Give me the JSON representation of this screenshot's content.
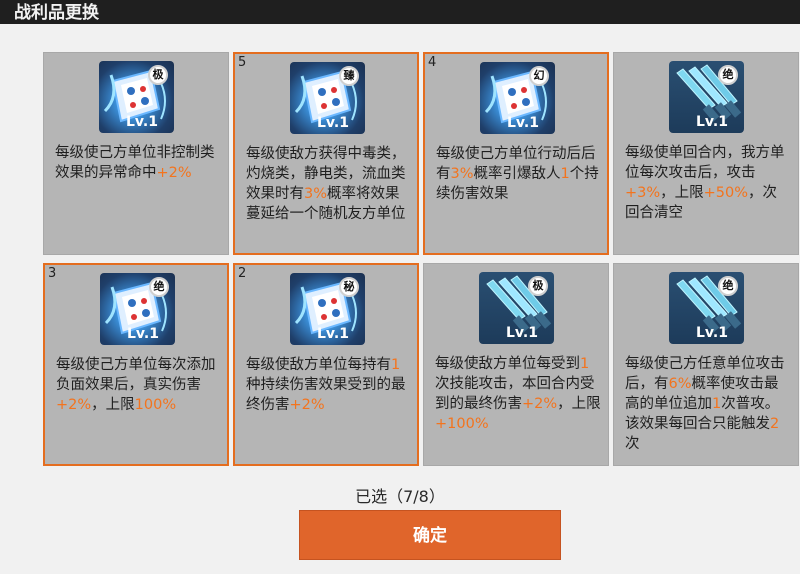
{
  "title": "战利品更换",
  "selected_text": "已选（7/8）",
  "confirm_label": "确定",
  "cards": [
    {
      "num": "",
      "icon": "card-icon",
      "badge": "极",
      "lvl": "Lv.1",
      "selected": false,
      "desc": [
        {
          "t": "每级使己方单位非控制类效果的异常命中"
        },
        {
          "t": "+2%",
          "h": 1
        }
      ]
    },
    {
      "num": "5",
      "icon": "card-icon",
      "badge": "臻",
      "lvl": "Lv.1",
      "selected": true,
      "desc": [
        {
          "t": "每级使敌方获得中毒类，灼烧类，静电类，流血类效果时有"
        },
        {
          "t": "3%",
          "h": 1
        },
        {
          "t": "概率将效果蔓延给一个随机友方单位"
        }
      ]
    },
    {
      "num": "4",
      "icon": "card-icon",
      "badge": "幻",
      "lvl": "Lv.1",
      "selected": true,
      "desc": [
        {
          "t": "每级使己方单位行动后后有"
        },
        {
          "t": "3%",
          "h": 1
        },
        {
          "t": "概率引爆敌人"
        },
        {
          "t": "1",
          "h": 1
        },
        {
          "t": "个持续伤害效果"
        }
      ]
    },
    {
      "num": "",
      "icon": "sword-icon",
      "badge": "绝",
      "lvl": "Lv.1",
      "selected": false,
      "desc": [
        {
          "t": "每级使单回合内，我方单位每次攻击后，攻击"
        },
        {
          "t": "+3%",
          "h": 1
        },
        {
          "t": "，上限"
        },
        {
          "t": "+50%",
          "h": 1
        },
        {
          "t": "，次回合清空"
        }
      ]
    },
    {
      "num": "3",
      "icon": "card-icon",
      "badge": "绝",
      "lvl": "Lv.1",
      "selected": true,
      "desc": [
        {
          "t": "每级使己方单位每次添加负面效果后，真实伤害"
        },
        {
          "t": "+2%",
          "h": 1
        },
        {
          "t": "，上限"
        },
        {
          "t": "100%",
          "h": 1
        }
      ]
    },
    {
      "num": "2",
      "icon": "card-icon",
      "badge": "秘",
      "lvl": "Lv.1",
      "selected": true,
      "desc": [
        {
          "t": "每级使敌方单位每持有"
        },
        {
          "t": "1",
          "h": 1
        },
        {
          "t": "种持续伤害效果受到的最终伤害"
        },
        {
          "t": "+2%",
          "h": 1
        }
      ]
    },
    {
      "num": "",
      "icon": "sword-icon",
      "badge": "极",
      "lvl": "Lv.1",
      "selected": false,
      "desc": [
        {
          "t": "每级使敌方单位每受到"
        },
        {
          "t": "1",
          "h": 1
        },
        {
          "t": "次技能攻击，本回合内受到的最终伤害"
        },
        {
          "t": "+2%",
          "h": 1
        },
        {
          "t": "，上限"
        },
        {
          "t": "+100%",
          "h": 1
        }
      ]
    },
    {
      "num": "",
      "icon": "sword-icon",
      "badge": "绝",
      "lvl": "Lv.1",
      "selected": false,
      "desc": [
        {
          "t": "每级使己方任意单位攻击后，有"
        },
        {
          "t": "6%",
          "h": 1
        },
        {
          "t": "概率使攻击最高的单位追加"
        },
        {
          "t": "1",
          "h": 1
        },
        {
          "t": "次普攻。该效果每回合只能触发"
        },
        {
          "t": "2",
          "h": 1
        },
        {
          "t": "次"
        }
      ]
    }
  ]
}
